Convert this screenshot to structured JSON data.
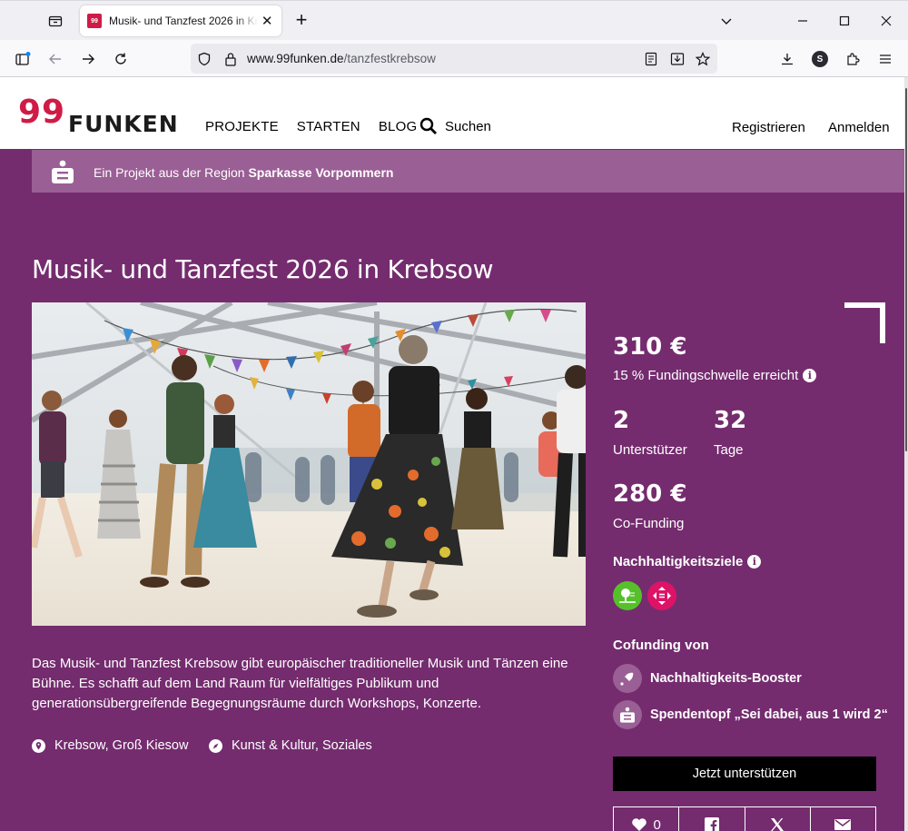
{
  "browser": {
    "tab_title": "Musik- und Tanzfest 2026 in Krebsow",
    "favicon_text": "99",
    "url_host": "www.99funken.de",
    "url_path": "/tanzfestkrebsow",
    "profile_initial": "S"
  },
  "header": {
    "logo_99": "99",
    "logo_funken": "FUNKEN",
    "nav": [
      "PROJEKTE",
      "STARTEN",
      "BLOG"
    ],
    "search_label": "Suchen",
    "register": "Registrieren",
    "login": "Anmelden"
  },
  "region": {
    "prefix": "Ein Projekt aus der Region ",
    "bank": "Sparkasse Vorpommern"
  },
  "project": {
    "title": "Musik- und Tanzfest 2026 in Krebsow",
    "description": "Das Musik- und Tanzfest Krebsow gibt europäischer traditioneller Musik und Tänzen eine Bühne. Es schafft auf dem Land Raum für vielfältiges Publikum und generationsübergreifende Begegnungsräume durch Workshops, Konzerte.",
    "location": "Krebsow, Groß Kiesow",
    "categories": "Kunst & Kultur, Soziales"
  },
  "stats": {
    "amount": "310 €",
    "threshold_text": "15 % Fundingschwelle erreicht",
    "supporters_count": "2",
    "supporters_label": "Unterstützer",
    "days_count": "32",
    "days_label": "Tage",
    "cofunding_amount": "280 €",
    "cofunding_label": "Co-Funding",
    "sustainability_heading": "Nachhaltigkeitsziele",
    "cofunding_heading": "Cofunding von",
    "cofunders": [
      "Nachhaltigkeits-Booster",
      "Spendentopf „Sei dabei, aus 1 wird 2“"
    ],
    "support_button": "Jetzt unterstützen",
    "likes": "0"
  },
  "colors": {
    "brand_red": "#cf1b45",
    "page_purple": "#742c6e",
    "region_bar": "#9a5f94",
    "sdg_green": "#56c02b",
    "sdg_pink": "#dd1367"
  },
  "icons": {
    "tab_list": "tab-list-icon",
    "location": "location-pin-icon",
    "category": "compass-icon",
    "info": "info-icon",
    "like": "heart-icon",
    "share": [
      "facebook-icon",
      "x-icon",
      "mail-icon"
    ]
  }
}
